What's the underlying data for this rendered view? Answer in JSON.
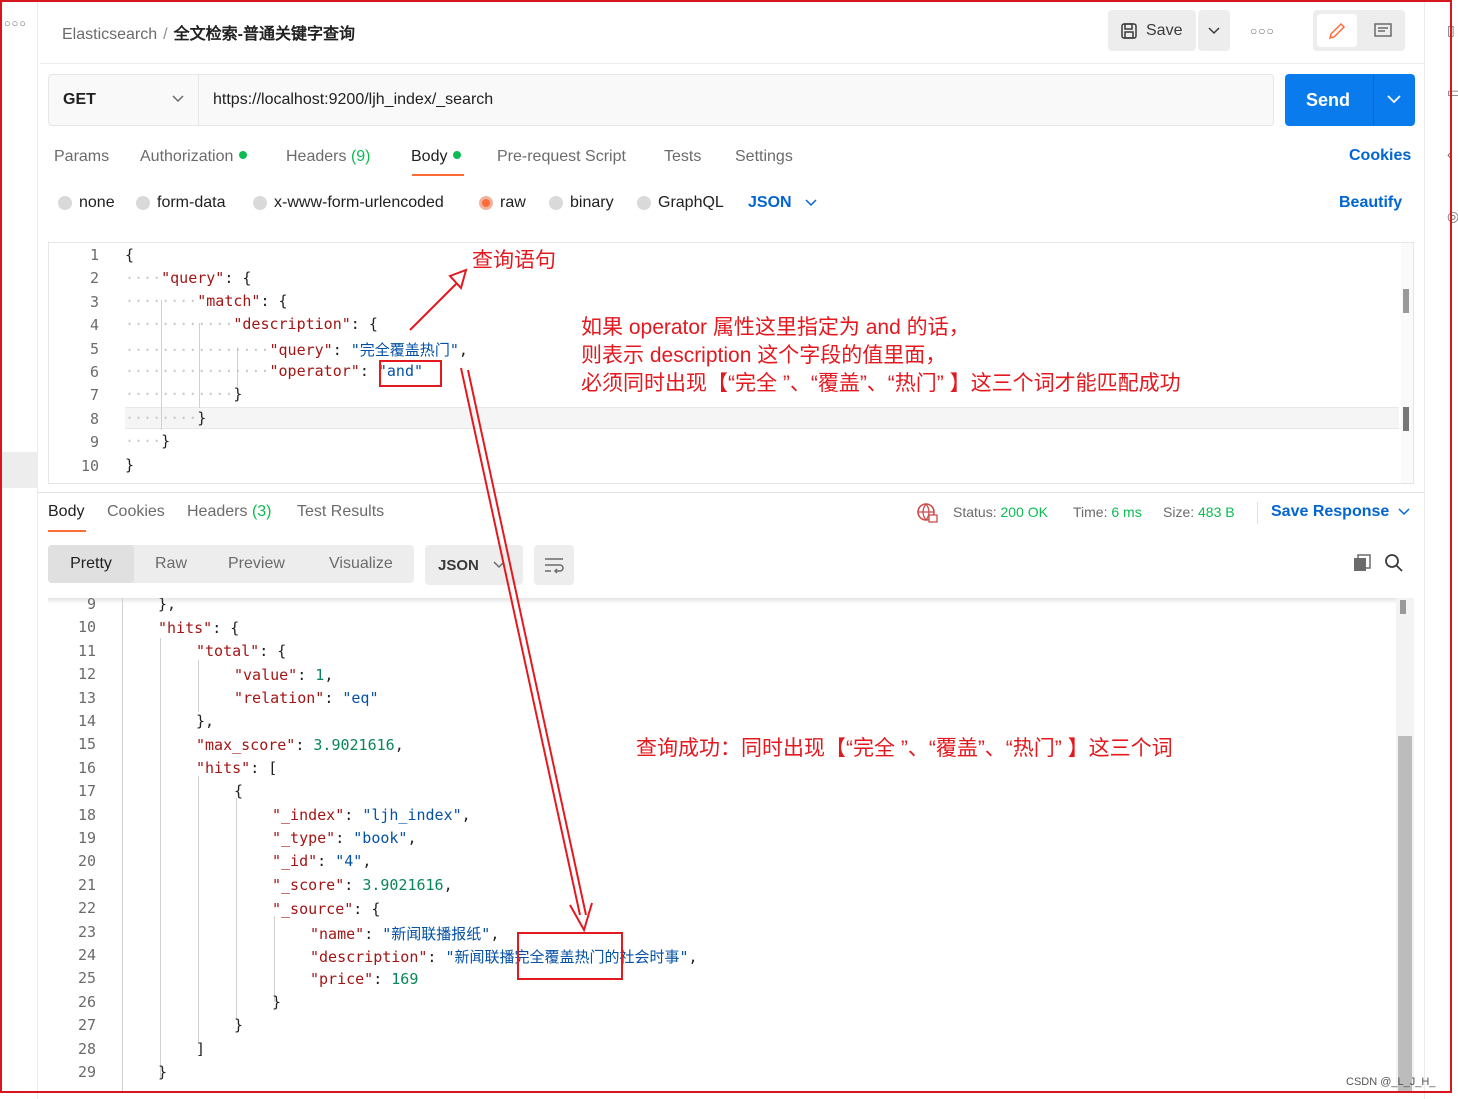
{
  "header": {
    "collection": "Elasticsearch",
    "separator": "/",
    "request_name": "全文检索-普通关键字查询",
    "save_label": "Save"
  },
  "request": {
    "method": "GET",
    "url": "https://localhost:9200/ljh_index/_search",
    "send_label": "Send"
  },
  "request_tabs": {
    "params": "Params",
    "authorization": "Authorization",
    "headers": "Headers",
    "headers_count": "(9)",
    "body": "Body",
    "prerequest": "Pre-request Script",
    "tests": "Tests",
    "settings": "Settings",
    "cookies": "Cookies"
  },
  "body_types": {
    "none": "none",
    "form_data": "form-data",
    "urlencoded": "x-www-form-urlencoded",
    "raw": "raw",
    "binary": "binary",
    "graphql": "GraphQL",
    "format": "JSON",
    "beautify": "Beautify",
    "selected": "raw"
  },
  "request_line_numbers": [
    "1",
    "2",
    "3",
    "4",
    "5",
    "6",
    "7",
    "8",
    "9",
    "10"
  ],
  "response_tabs": {
    "body": "Body",
    "cookies": "Cookies",
    "headers": "Headers",
    "headers_count": "(3)",
    "test_results": "Test Results"
  },
  "response_meta": {
    "status_label": "Status:",
    "status_value": "200 OK",
    "time_label": "Time:",
    "time_value": "6 ms",
    "size_label": "Size:",
    "size_value": "483 B",
    "save_response": "Save Response"
  },
  "view_modes": {
    "pretty": "Pretty",
    "raw": "Raw",
    "preview": "Preview",
    "visualize": "Visualize",
    "format": "JSON"
  },
  "response_line_numbers": [
    "9",
    "10",
    "11",
    "12",
    "13",
    "14",
    "15",
    "16",
    "17",
    "18",
    "19",
    "20",
    "21",
    "22",
    "23",
    "24",
    "25",
    "26",
    "27",
    "28",
    "29"
  ],
  "annotations": {
    "query_label": "查询语句",
    "explain_line1": "如果 operator 属性这里指定为 and 的话，",
    "explain_line2": "则表示 description 这个字段的值里面，",
    "explain_line3": "必须同时出现【“完全 ”、“覆盖”、“热门” 】这三个词才能匹配成功",
    "success_label": "查询成功：同时出现【“完全 ”、“覆盖”、“热门” 】这三个词"
  },
  "watermark": "CSDN @_L_J_H_",
  "colors": {
    "accent_orange": "#ff6c37",
    "send_blue": "#097bed",
    "link_blue": "#0265d2",
    "status_green": "#0cbb52",
    "annotation_red": "#e3191f"
  }
}
